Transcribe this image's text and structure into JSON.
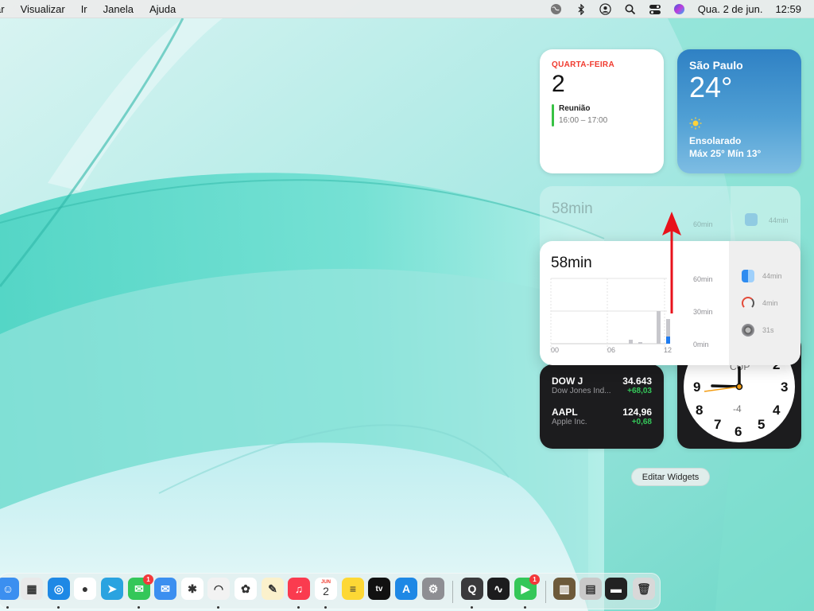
{
  "menubar": {
    "menus": [
      "ar",
      "Visualizar",
      "Ir",
      "Janela",
      "Ajuda"
    ],
    "datetime": "Qua. 2 de jun.",
    "time": "12:59",
    "icons": [
      "globe-icon",
      "bluetooth-icon",
      "user-icon",
      "search-icon",
      "control-center-icon",
      "siri-icon"
    ]
  },
  "calendar_widget": {
    "weekday": "QUARTA-FEIRA",
    "day": "2",
    "event_title": "Reunião",
    "event_time": "16:00 – 17:00",
    "event_color": "#38c244"
  },
  "weather_widget": {
    "city": "São Paulo",
    "temperature": "24°",
    "condition": "Ensolarado",
    "range": "Máx 25° Mín 13°",
    "icon": "sun-icon"
  },
  "screentime_widget": {
    "total": "58min",
    "axis_labels": [
      "60min",
      "30min",
      "0min"
    ],
    "x_labels": [
      "00",
      "06",
      "12"
    ],
    "apps": [
      {
        "name": "finder-icon",
        "time": "44min"
      },
      {
        "name": "scrobbler-icon",
        "time": "4min"
      },
      {
        "name": "system-preferences-icon",
        "time": "31s"
      }
    ]
  },
  "ghost_widget": {
    "total": "58min",
    "axis_label": "60min",
    "app_time": "44min"
  },
  "stocks_widget": {
    "items": [
      {
        "symbol": "DOW J",
        "name": "Dow Jones Ind...",
        "price": "34.643",
        "change": "+68,03"
      },
      {
        "symbol": "AAPL",
        "name": "Apple Inc.",
        "price": "124,96",
        "change": "+0,68"
      }
    ],
    "change_color": "#34c759"
  },
  "clock_widget": {
    "numbers": [
      "9",
      "3",
      "8",
      "4",
      "7",
      "5",
      "6",
      "2",
      "CUP",
      "-4"
    ]
  },
  "edit_widgets_label": "Editar Widgets",
  "dock": {
    "apps": [
      {
        "name": "finder",
        "color": "#3b8ff0",
        "glyph": "☺"
      },
      {
        "name": "launchpad",
        "color": "#e9e9e9",
        "glyph": "▦"
      },
      {
        "name": "safari",
        "color": "#1e88e5",
        "glyph": "◎"
      },
      {
        "name": "chrome",
        "color": "#ffffff",
        "glyph": "●"
      },
      {
        "name": "telegram",
        "color": "#2aa3e0",
        "glyph": "➤"
      },
      {
        "name": "messages",
        "color": "#34c759",
        "glyph": "✉",
        "badge": "1"
      },
      {
        "name": "mail",
        "color": "#3b8ff0",
        "glyph": "✉"
      },
      {
        "name": "slack",
        "color": "#ffffff",
        "glyph": "✱"
      },
      {
        "name": "scrobbles",
        "color": "#f2f2f2",
        "glyph": "◠"
      },
      {
        "name": "photos",
        "color": "#ffffff",
        "glyph": "✿"
      },
      {
        "name": "script-editor",
        "color": "#fbf1cc",
        "glyph": "✎"
      },
      {
        "name": "music",
        "color": "#fa3b4f",
        "glyph": "♫"
      },
      {
        "name": "calendar",
        "color": "#ffffff",
        "glyph": "2"
      },
      {
        "name": "notes",
        "color": "#fdd835",
        "glyph": "≡"
      },
      {
        "name": "tv",
        "color": "#111111",
        "glyph": "tv"
      },
      {
        "name": "app-store",
        "color": "#1e88e5",
        "glyph": "A"
      },
      {
        "name": "system-preferences",
        "color": "#8e8e93",
        "glyph": "⚙"
      },
      {
        "name": "quicktime",
        "color": "#3a3a3c",
        "glyph": "Q"
      },
      {
        "name": "activity-monitor",
        "color": "#1c1c1e",
        "glyph": "∿"
      },
      {
        "name": "facetime",
        "color": "#34c759",
        "glyph": "▶",
        "badge": "1"
      },
      {
        "name": "doc-thumb-1",
        "color": "#6d5a3a",
        "glyph": "▥"
      },
      {
        "name": "doc-thumb-2",
        "color": "#c9c9c9",
        "glyph": "▤"
      },
      {
        "name": "doc-thumb-3",
        "color": "#222222",
        "glyph": "▬"
      },
      {
        "name": "trash",
        "color": "#d8d8d8",
        "glyph": "🗑"
      }
    ],
    "calendar_month": "JUN"
  }
}
